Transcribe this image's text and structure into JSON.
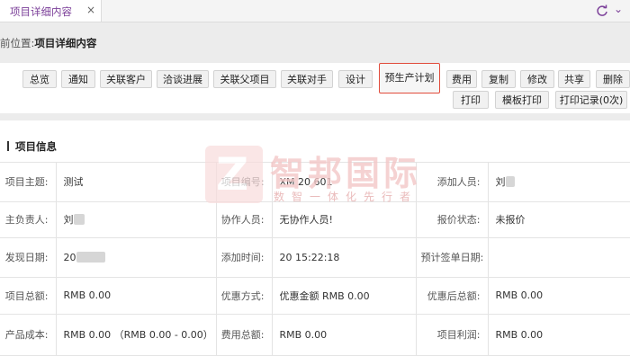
{
  "tab": {
    "label": "项目详细内容",
    "close": "×"
  },
  "breadcrumb": {
    "prefix": "前位置:",
    "current": "项目详细内容"
  },
  "toolbar": {
    "row1": [
      "总览",
      "通知",
      "关联客户",
      "洽谈进展",
      "关联父项目",
      "关联对手",
      "设计",
      "预生产计划",
      "费用",
      "复制",
      "修改",
      "共享",
      "删除"
    ],
    "row2": [
      "打印",
      "模板打印",
      "打印记录(0次)"
    ],
    "highlight_color": "#e14b3b"
  },
  "section": {
    "title": "项目信息"
  },
  "rows": [
    {
      "cells": [
        {
          "label": "项目主题:",
          "value": "测试"
        },
        {
          "label": "项目编号:",
          "value": "XM 20      601"
        },
        {
          "label": "添加人员:",
          "value": "刘"
        }
      ]
    },
    {
      "cells": [
        {
          "label": "主负责人:",
          "value": "刘"
        },
        {
          "label": "协作人员:",
          "value": "无协作人员!"
        },
        {
          "label": "报价状态:",
          "value": "未报价"
        }
      ]
    },
    {
      "cells": [
        {
          "label": "发现日期:",
          "value": "20"
        },
        {
          "label": "添加时间:",
          "value": "20       15:22:18"
        },
        {
          "label": "预计签单日期:",
          "value": ""
        }
      ]
    },
    {
      "cells": [
        {
          "label": "项目总额:",
          "value": "RMB 0.00"
        },
        {
          "label": "优惠方式:",
          "value": "优惠金额 RMB 0.00"
        },
        {
          "label": "优惠后总额:",
          "value": "RMB 0.00"
        }
      ]
    },
    {
      "cells": [
        {
          "label": "产品成本:",
          "value": "RMB 0.00 （RMB 0.00 - 0.00）"
        },
        {
          "label": "费用总额:",
          "value": "RMB 0.00"
        },
        {
          "label": "项目利润:",
          "value": "RMB 0.00"
        }
      ]
    }
  ],
  "watermark": {
    "logo_letter": "Z",
    "name": "智邦国际",
    "slogan": "数智一体化先行者"
  },
  "colors": {
    "accent": "#7b3f99",
    "watermark": "#f3c7c7"
  }
}
